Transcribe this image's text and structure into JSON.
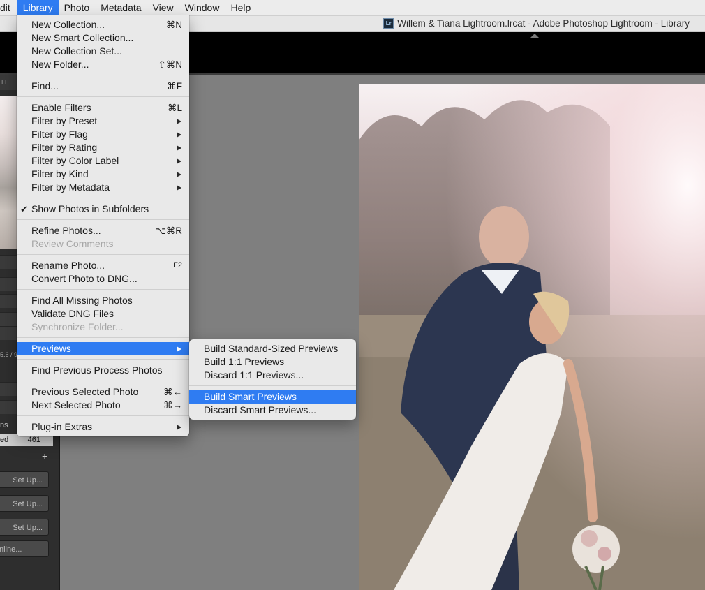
{
  "menubar": {
    "items": [
      {
        "label": "dit"
      },
      {
        "label": "Library"
      },
      {
        "label": "Photo"
      },
      {
        "label": "Metadata"
      },
      {
        "label": "View"
      },
      {
        "label": "Window"
      },
      {
        "label": "Help"
      }
    ]
  },
  "window": {
    "title": "Willem & Tiana Lightroom.lrcat - Adobe Photoshop Lightroom - Library",
    "app_icon_text": "Lr"
  },
  "left_panel": {
    "tab_text": "LL",
    "meta_text": "5.6 / 9",
    "collection_label": "ns",
    "published_label": "ed",
    "published_count": "461",
    "add_symbol": "+",
    "setup_buttons": [
      "Set Up...",
      "Set Up...",
      "Set Up..."
    ],
    "online_button": "nline..."
  },
  "library_menu": {
    "new_collection": {
      "label": "New Collection...",
      "shortcut": "⌘N"
    },
    "new_smart_collection": {
      "label": "New Smart Collection..."
    },
    "new_collection_set": {
      "label": "New Collection Set..."
    },
    "new_folder": {
      "label": "New Folder...",
      "shortcut": "⇧⌘N"
    },
    "find": {
      "label": "Find...",
      "shortcut": "⌘F"
    },
    "enable_filters": {
      "label": "Enable Filters",
      "shortcut": "⌘L"
    },
    "filter_by_preset": {
      "label": "Filter by Preset"
    },
    "filter_by_flag": {
      "label": "Filter by Flag"
    },
    "filter_by_rating": {
      "label": "Filter by Rating"
    },
    "filter_by_color_label": {
      "label": "Filter by Color Label"
    },
    "filter_by_kind": {
      "label": "Filter by Kind"
    },
    "filter_by_metadata": {
      "label": "Filter by Metadata"
    },
    "show_photos_in_subfolders": {
      "label": "Show Photos in Subfolders",
      "checkmark": "✔"
    },
    "refine_photos": {
      "label": "Refine Photos...",
      "shortcut": "⌥⌘R"
    },
    "review_comments": {
      "label": "Review Comments"
    },
    "rename_photo": {
      "label": "Rename Photo...",
      "shortcut": "F2"
    },
    "convert_to_dng": {
      "label": "Convert Photo to DNG..."
    },
    "find_missing": {
      "label": "Find All Missing Photos"
    },
    "validate_dng": {
      "label": "Validate DNG Files"
    },
    "synchronize_folder": {
      "label": "Synchronize Folder..."
    },
    "previews": {
      "label": "Previews"
    },
    "find_previous_process": {
      "label": "Find Previous Process Photos"
    },
    "previous_selected": {
      "label": "Previous Selected Photo",
      "shortcut": "⌘←"
    },
    "next_selected": {
      "label": "Next Selected Photo",
      "shortcut": "⌘→"
    },
    "plugin_extras": {
      "label": "Plug-in Extras"
    }
  },
  "previews_submenu": {
    "build_standard": {
      "label": "Build Standard-Sized Previews"
    },
    "build_1to1": {
      "label": "Build 1:1 Previews"
    },
    "discard_1to1": {
      "label": "Discard 1:1 Previews..."
    },
    "build_smart": {
      "label": "Build Smart Previews"
    },
    "discard_smart": {
      "label": "Discard Smart Previews..."
    }
  },
  "colors": {
    "accent": "#2f7cf2",
    "menu_bg": "#e9e9e9",
    "workspace_bg": "#7f7f7f",
    "panel_bg": "#2e2e2e"
  }
}
